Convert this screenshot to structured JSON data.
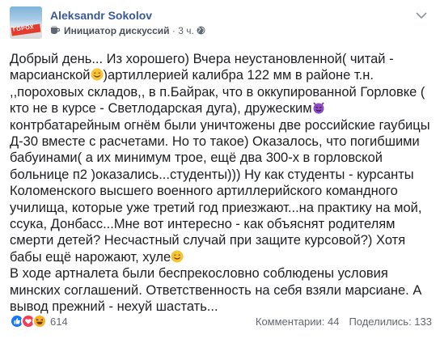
{
  "post": {
    "author": "Aleksandr Sokolov",
    "avatar_text": "ГОРОХ",
    "badge_icon": "coffee-cup-icon",
    "badge_label": "Инициатор дискуссий",
    "separator": " · ",
    "time": "3 ч.",
    "privacy_icon": "globe-icon",
    "menu_icon": "chevron-down-icon",
    "body": [
      {
        "parts": [
          {
            "t": "Добрый день... Из хорошего) Вчера неустановленной( читай - марсианской"
          },
          {
            "emoji": "smiling-face-emoji"
          },
          {
            "t": ")артиллерией калибра 122 мм в районе т.н. ,,пороховых складов,, в п.Байрак, что в оккупированной Горловке ( кто не в курсе - Светлодарская дуга), дружеским"
          },
          {
            "emoji": "purple-devil-emoji"
          },
          {
            "t": " контрбатарейным огнём были уничтожены две российские гаубицы Д-30 вместе с расчетами. Но то такое) Оказалось, что погибшими бабуинами( а их минимум трое, ещё два 300-х в горловской больнице п2 )оказались...студенты))) Ну как студенты - курсанты Коломенского высшего военного артиллерийского командного училища, которые уже третий год приезжают...на практику на мой, ссука, Донбасс...Мне вот интересно - как объяснят родителям смерти детей? Несчастный случай при защите курсовой?) Хотя бабы ещё нарожают, хуле"
          },
          {
            "emoji": "smiling-face-emoji"
          }
        ]
      },
      {
        "parts": [
          {
            "t": "В ходе артналета были беспрекословно соблюдены условия минских соглашений. Ответственность на себя взяли марсиане. А вывод прежний - нехуй шастать..."
          }
        ]
      }
    ]
  },
  "footer": {
    "reactions": [
      "like-reaction-icon",
      "love-reaction-icon",
      "haha-reaction-icon"
    ],
    "reaction_count": "614",
    "comments": "Комментарии: 44",
    "shares": "Поделились: 133"
  },
  "colors": {
    "author": "#385898",
    "text": "#1c1e21",
    "meta": "#606770",
    "like": "#1877f2",
    "love": "#f33e58",
    "haha": "#f7b125"
  }
}
